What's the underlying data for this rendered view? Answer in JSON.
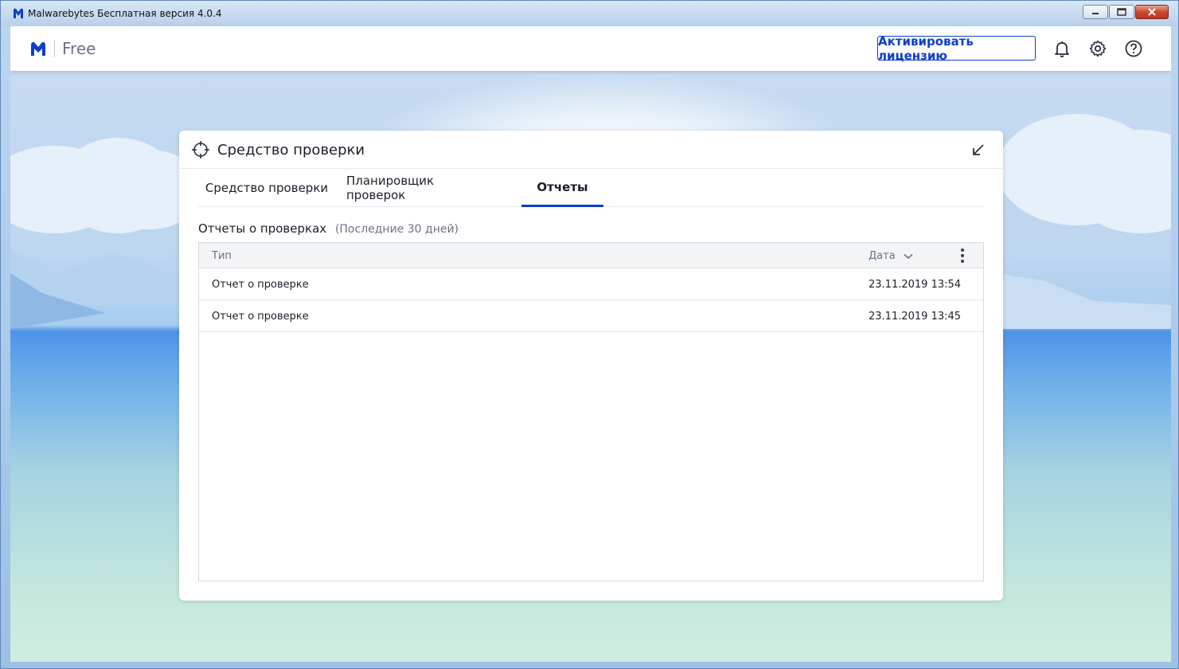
{
  "window": {
    "title": "Malwarebytes Бесплатная версия  4.0.4",
    "buttons": {
      "minimize": "▁",
      "maximize": "▭",
      "close": "✕"
    }
  },
  "header": {
    "edition": "Free",
    "activate_label": "Активировать лицензию",
    "icons": [
      "bell-icon",
      "gear-icon",
      "help-icon"
    ]
  },
  "panel": {
    "title": "Средство проверки",
    "tabs": [
      {
        "label": "Средство проверки",
        "active": false
      },
      {
        "label": "Планировщик проверок",
        "active": false
      },
      {
        "label": "Отчеты",
        "active": true
      }
    ],
    "section": {
      "title": "Отчеты о проверках",
      "subtitle": "(Последние 30 дней)"
    },
    "table": {
      "columns": {
        "type": "Тип",
        "date": "Дата"
      },
      "rows": [
        {
          "type": "Отчет о проверке",
          "date": "23.11.2019 13:54"
        },
        {
          "type": "Отчет о проверке",
          "date": "23.11.2019 13:45"
        }
      ]
    }
  },
  "colors": {
    "accent": "#0d3ecb",
    "brand": "#0d3ecb"
  }
}
